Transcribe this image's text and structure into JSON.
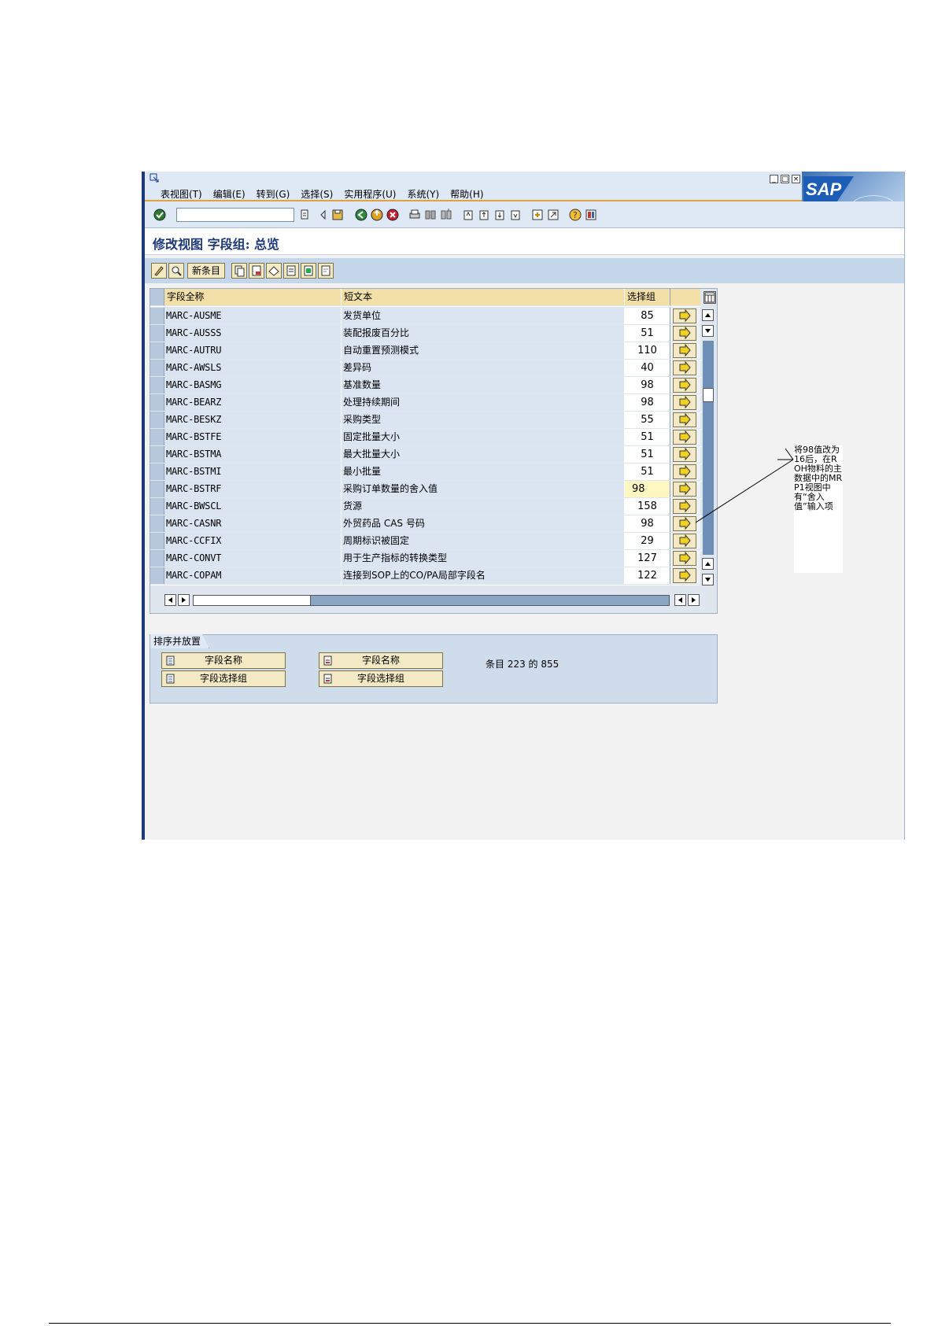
{
  "menubar": {
    "items": [
      "表视图(T)",
      "编辑(E)",
      "转到(G)",
      "选择(S)",
      "实用程序(U)",
      "系统(Y)",
      "帮助(H)"
    ],
    "logo_text": "SAP"
  },
  "title": "修改视图 字段组: 总览",
  "app_toolbar": {
    "new_entries_label": "新条目"
  },
  "table": {
    "headers": {
      "field_name": "字段全称",
      "short_text": "短文本",
      "select_group": "选择组"
    },
    "rows": [
      {
        "field": "MARC-AUSME",
        "text": "发货单位",
        "group": "85"
      },
      {
        "field": "MARC-AUSSS",
        "text": "装配报废百分比",
        "group": "51"
      },
      {
        "field": "MARC-AUTRU",
        "text": "自动重置预测模式",
        "group": "110"
      },
      {
        "field": "MARC-AWSLS",
        "text": "差异码",
        "group": "40"
      },
      {
        "field": "MARC-BASMG",
        "text": "基准数量",
        "group": "98"
      },
      {
        "field": "MARC-BEARZ",
        "text": "处理持续期间",
        "group": "98"
      },
      {
        "field": "MARC-BESKZ",
        "text": "采购类型",
        "group": "55"
      },
      {
        "field": "MARC-BSTFE",
        "text": "固定批量大小",
        "group": "51"
      },
      {
        "field": "MARC-BSTMA",
        "text": "最大批量大小",
        "group": "51"
      },
      {
        "field": "MARC-BSTMI",
        "text": "最小批量",
        "group": "51"
      },
      {
        "field": "MARC-BSTRF",
        "text": "采购订单数量的舍入值",
        "group": "98"
      },
      {
        "field": "MARC-BWSCL",
        "text": "货源",
        "group": "158"
      },
      {
        "field": "MARC-CASNR",
        "text": "外贸药品 CAS 号码",
        "group": "98"
      },
      {
        "field": "MARC-CCFIX",
        "text": "周期标识被固定",
        "group": "29"
      },
      {
        "field": "MARC-CONVT",
        "text": "用于生产指标的转换类型",
        "group": "127"
      },
      {
        "field": "MARC-COPAM",
        "text": "连接到SOP上的CO/PA局部字段名",
        "group": "122"
      }
    ],
    "active_row": 10
  },
  "sort": {
    "group_title": "排序并放置",
    "buttons": {
      "sort_field_name": "字段名称",
      "sort_field_group": "字段选择组",
      "position_field_name": "字段名称",
      "position_field_group": "字段选择组"
    },
    "entry_info": "条目 223 的 855"
  },
  "annotation": "将98值改为16后，在ROH物料的主数据中的MRP1视图中有“舍入值”输入项",
  "colors": {
    "header": "#f3dfa8",
    "bar": "#c4d6ea",
    "accent": "#1f3a78"
  }
}
